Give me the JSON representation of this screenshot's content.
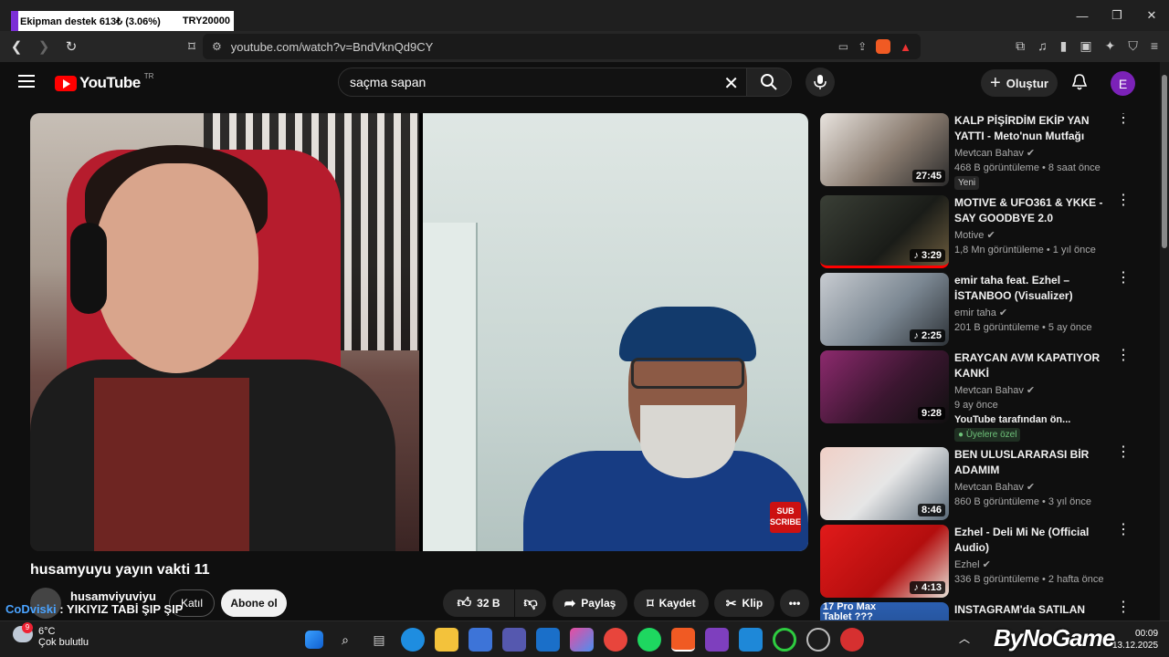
{
  "overlay": {
    "donation_text": "Ekipman destek  613₺ (3.06%)",
    "goal": "TRY20000",
    "progress_percent": 3.06
  },
  "browser": {
    "url": "youtube.com/watch?v=BndVknQd9CY"
  },
  "header": {
    "logo_text": "YouTube",
    "region": "TR",
    "search_value": "saçma sapan",
    "create_label": "Oluştur",
    "avatar_letter": "E"
  },
  "video": {
    "title": "husamyuyu yayın vakti 11",
    "channel": "husamviyuviyu",
    "join_label": "Katıl",
    "subscribe_label": "Abone ol",
    "likes": "32 B",
    "share_label": "Paylaş",
    "save_label": "Kaydet",
    "clip_label": "Klip",
    "subscribe_badge": "SUB SCRIBE"
  },
  "chat": {
    "user": "CoDviski",
    "message": ": YIKIYIZ TABİ ŞIP ŞIP"
  },
  "sidebar": [
    {
      "title": "KALP PİŞİRDİM EKİP YAN YATTI - Meto'nun Mutfağı",
      "channel": "Mevtcan Bahav",
      "meta": "468 B görüntüleme • 8 saat önce",
      "duration": "27:45",
      "badge": "Yeni"
    },
    {
      "title": "MOTIVE & UFO361 & YKKE - SAY GOODBYE 2.0",
      "channel": "Motive",
      "meta": "1,8 Mn görüntüleme • 1 yıl önce",
      "duration": "3:29"
    },
    {
      "title": "emir taha feat. Ezhel – İSTANBOO (Visualizer)",
      "channel": "emir taha",
      "meta": "201 B görüntüleme • 5 ay önce",
      "duration": "2:25"
    },
    {
      "title": "ERAYCAN AVM KAPATIYOR KANKİ",
      "channel": "Mevtcan Bahav",
      "meta": "9 ay önce",
      "meta2": "YouTube tarafından ön...",
      "duration": "9:28",
      "badge": "Üyelere özel"
    },
    {
      "title": "BEN ULUSLARARASI BİR ADAMIM",
      "channel": "Mevtcan Bahav",
      "meta": "860 B görüntüleme • 3 yıl önce",
      "duration": "8:46"
    },
    {
      "title": "Ezhel - Deli Mi Ne (Official Audio)",
      "channel": "Ezhel",
      "meta": "336 B görüntüleme • 2 hafta önce",
      "duration": "4:13"
    },
    {
      "title": "INSTAGRAM'da SATILAN",
      "thumb_text": "17 Pro Max Tablet ???"
    }
  ],
  "taskbar": {
    "temp": "6°C",
    "weather": "Çok bulutlu",
    "weather_badge": "9",
    "time": "00:09",
    "date": "13.12.2025"
  },
  "watermark": "ByNoGame"
}
